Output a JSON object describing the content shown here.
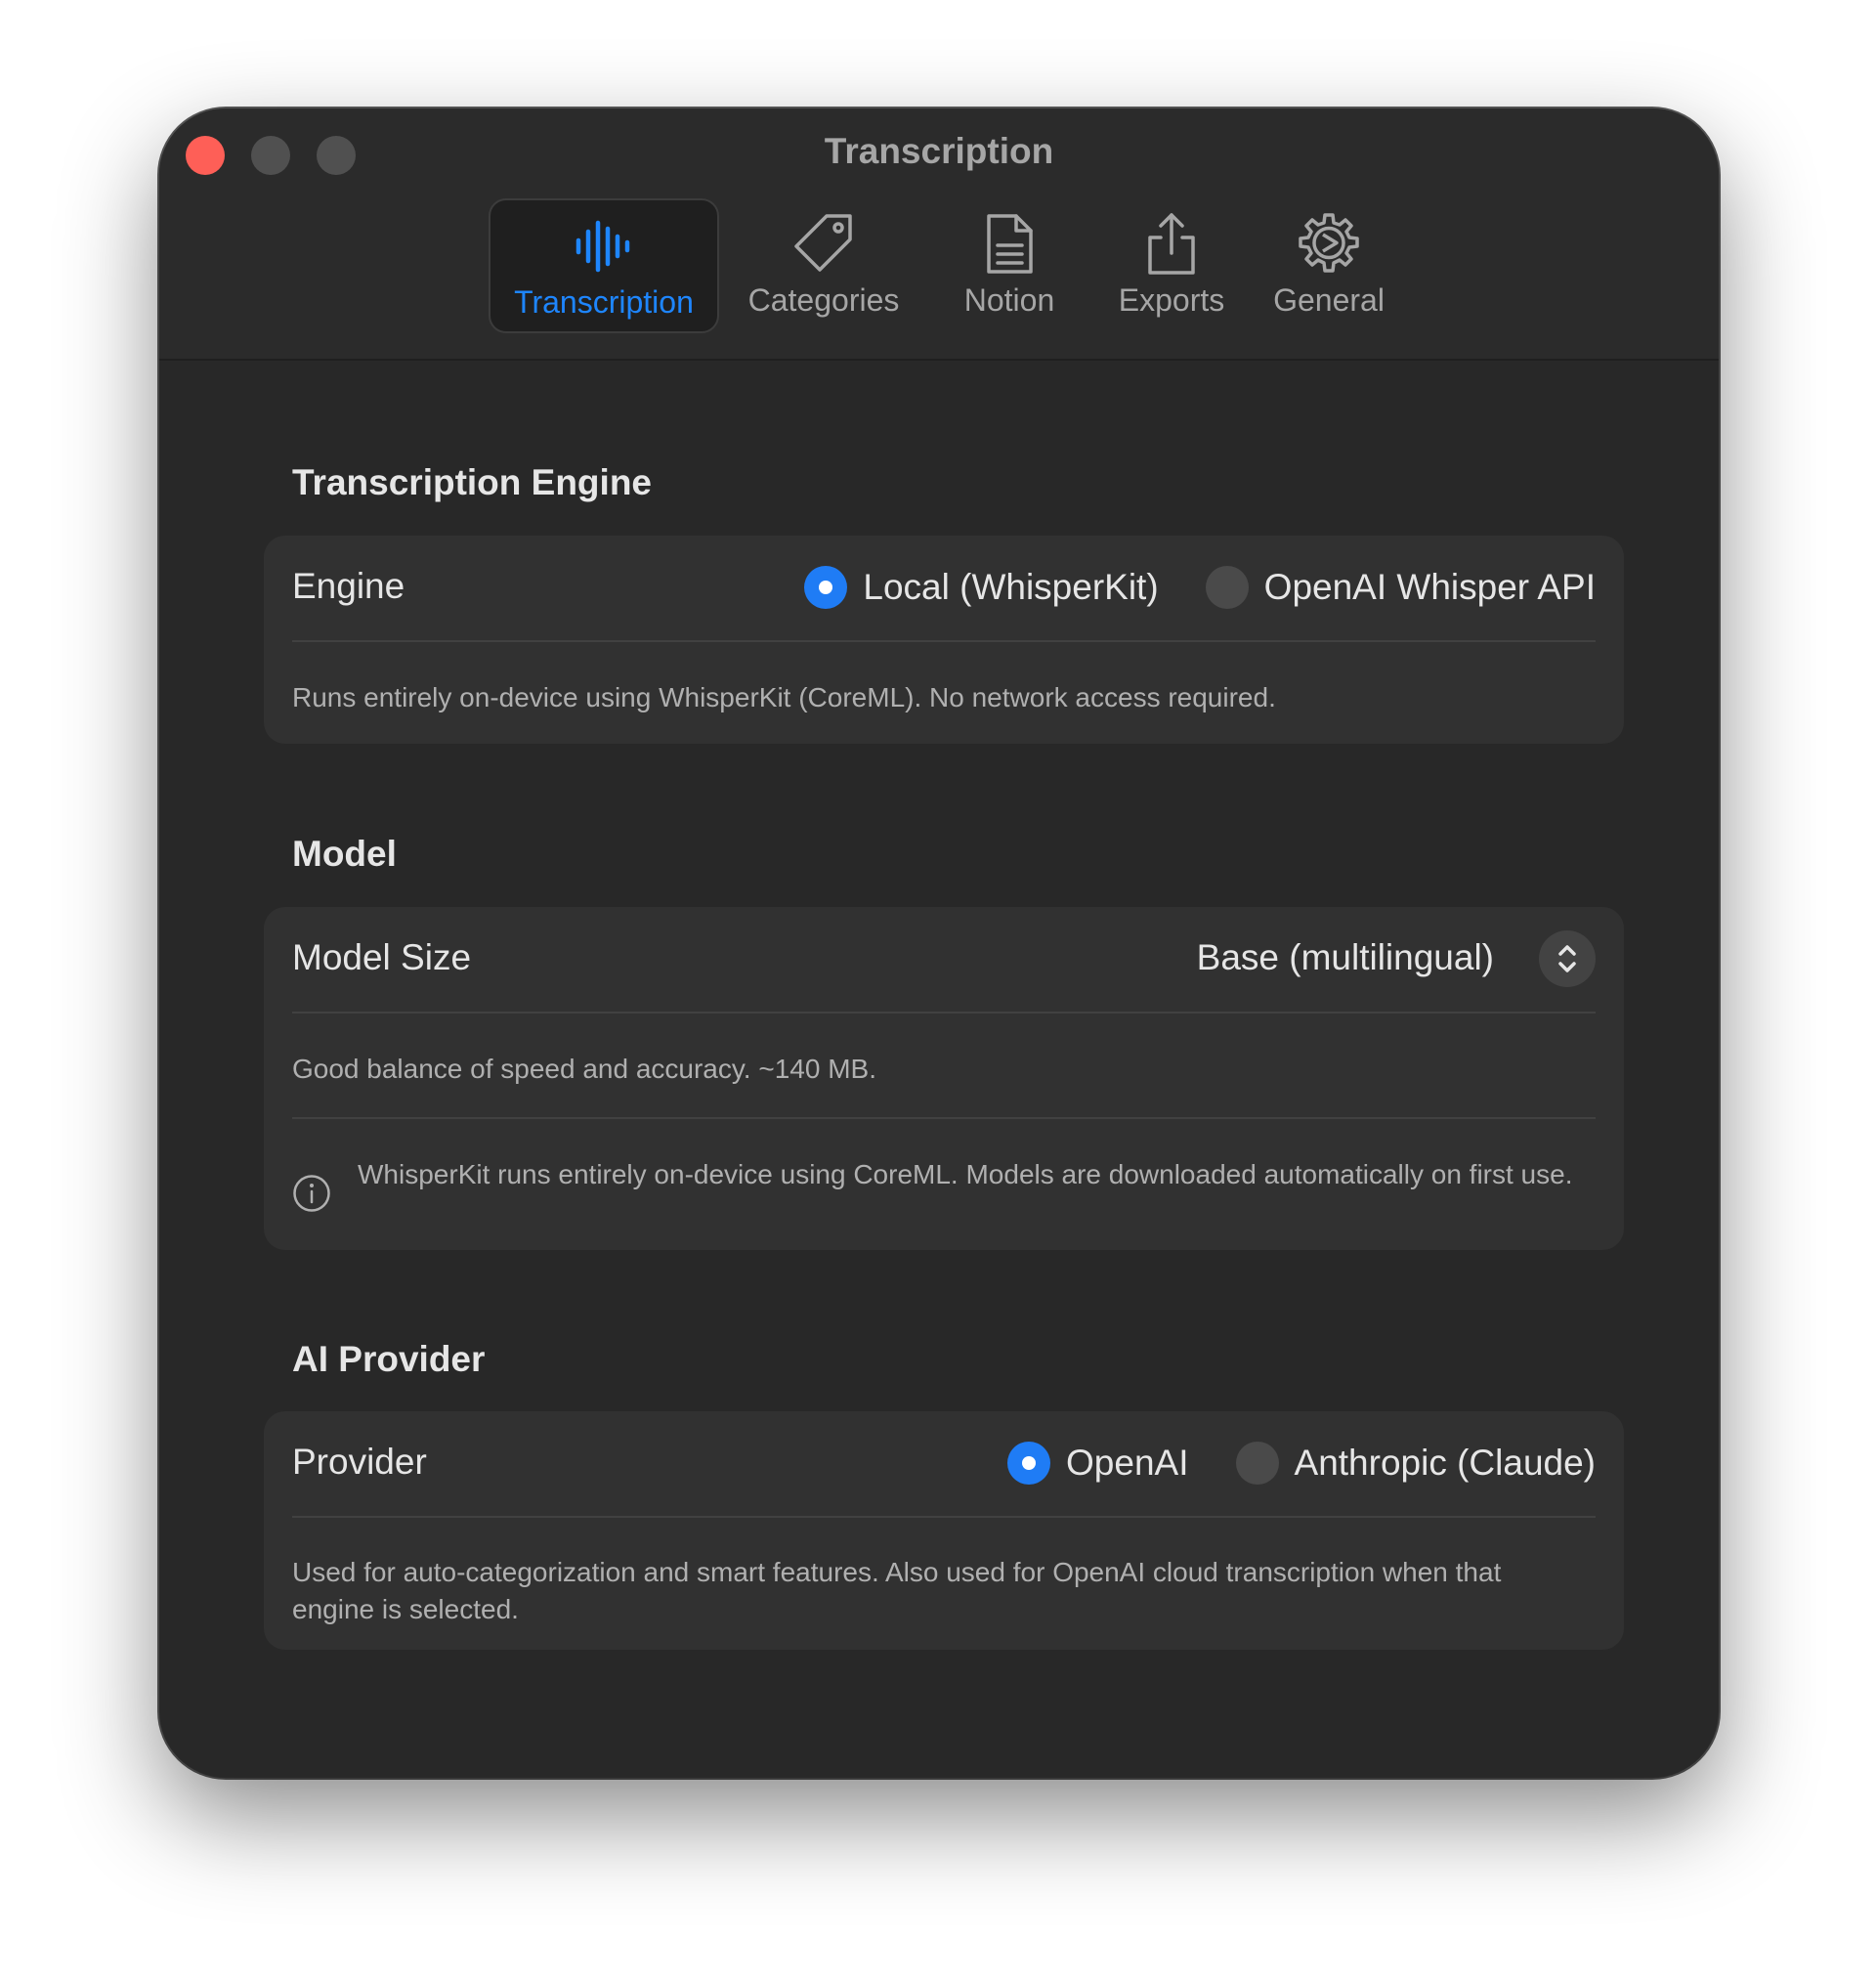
{
  "window": {
    "title": "Transcription"
  },
  "tabs": [
    {
      "label": "Transcription",
      "icon": "waveform-icon",
      "active": true
    },
    {
      "label": "Categories",
      "icon": "tag-icon",
      "active": false
    },
    {
      "label": "Notion",
      "icon": "document-icon",
      "active": false
    },
    {
      "label": "Exports",
      "icon": "share-icon",
      "active": false
    },
    {
      "label": "General",
      "icon": "gear-icon",
      "active": false
    }
  ],
  "sections": {
    "engine": {
      "title": "Transcription Engine",
      "row_label": "Engine",
      "options": [
        {
          "label": "Local (WhisperKit)",
          "selected": true
        },
        {
          "label": "OpenAI Whisper API",
          "selected": false
        }
      ],
      "helper": "Runs entirely on-device using WhisperKit (CoreML). No network access required."
    },
    "model": {
      "title": "Model",
      "row_label": "Model Size",
      "selected_value": "Base (multilingual)",
      "helper": "Good balance of speed and accuracy. ~140 MB.",
      "info": "WhisperKit runs entirely on-device using CoreML. Models are downloaded automatically on first use."
    },
    "provider": {
      "title": "AI Provider",
      "row_label": "Provider",
      "options": [
        {
          "label": "OpenAI",
          "selected": true
        },
        {
          "label": "Anthropic (Claude)",
          "selected": false
        }
      ],
      "helper": "Used for auto-categorization and smart features. Also used for OpenAI cloud transcription when that engine is selected."
    }
  },
  "colors": {
    "accent": "#1e86ff",
    "window_bg": "#282828",
    "card_bg": "#313131",
    "close": "#fe5f57"
  }
}
